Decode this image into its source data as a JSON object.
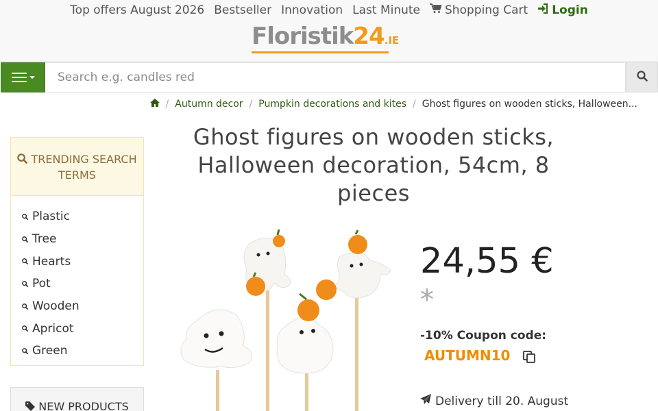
{
  "topnav": {
    "offers": "Top offers August 2026",
    "bestseller": "Bestseller",
    "innovation": "Innovation",
    "last_minute": "Last Minute",
    "cart": "Shopping Cart",
    "login": "Login"
  },
  "logo": {
    "main": "Floristik",
    "num": "24",
    "tld": ".IE"
  },
  "search": {
    "placeholder": "Search e.g. candles red",
    "value": ""
  },
  "breadcrumb": {
    "home_icon": "home-icon",
    "items": [
      "Autumn decor",
      "Pumpkin decorations and kites"
    ],
    "current": "Ghost figures on wooden sticks, Halloween..."
  },
  "sidebar": {
    "trending_title": "TRENDING SEARCH TERMS",
    "trending_items": [
      "Plastic",
      "Tree",
      "Hearts",
      "Pot",
      "Wooden",
      "Apricot",
      "Green"
    ],
    "new_products": "NEW PRODUCTS"
  },
  "product": {
    "title": "Ghost figures on wooden sticks, Halloween decoration, 54cm, 8 pieces",
    "price": "24,55 €",
    "asterisk": "*",
    "coupon_label": "-10% Coupon code:",
    "coupon_code": "AUTUMN10",
    "delivery": "Delivery till 20. August"
  },
  "colors": {
    "accent_green": "#4a8a23",
    "link_green": "#2e5b12",
    "coupon_orange": "#f08c00",
    "trend_header_bg": "#fcf8e3"
  }
}
